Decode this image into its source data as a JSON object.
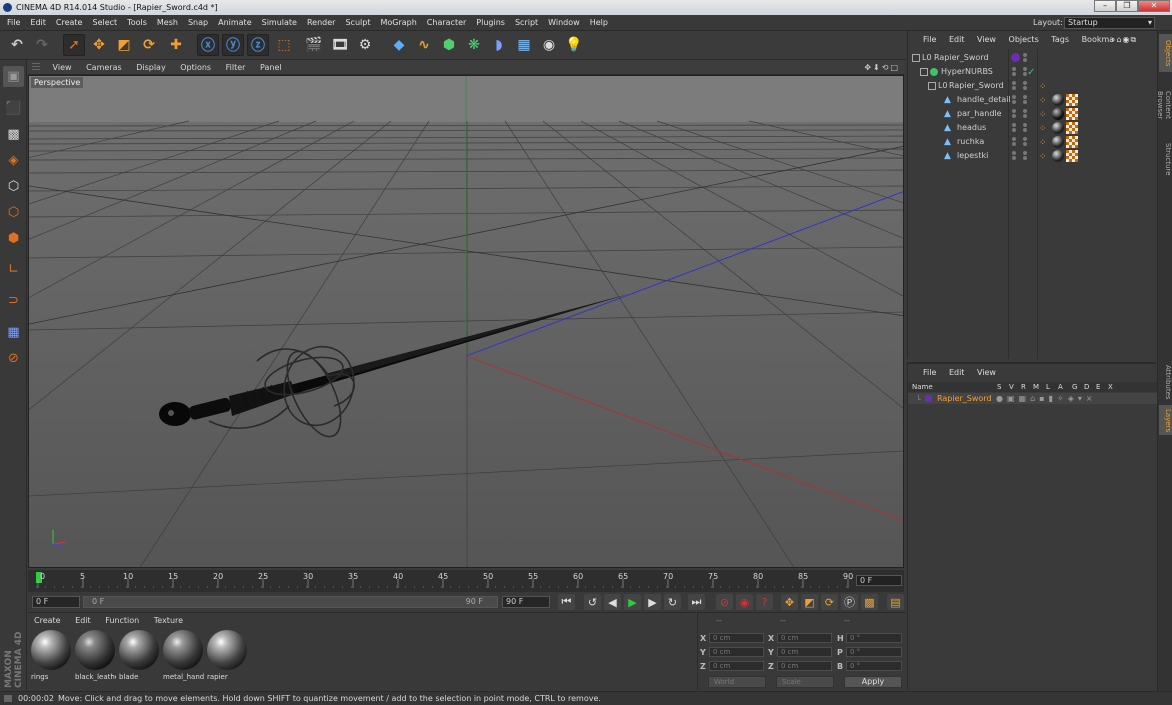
{
  "titlebar": {
    "title": "CINEMA 4D R14.014 Studio - [Rapier_Sword.c4d *]",
    "min": "–",
    "max": "❐",
    "close": "✕"
  },
  "menubar": {
    "items": [
      "File",
      "Edit",
      "Create",
      "Select",
      "Tools",
      "Mesh",
      "Snap",
      "Animate",
      "Simulate",
      "Render",
      "Sculpt",
      "MoGraph",
      "Character",
      "Plugins",
      "Script",
      "Window",
      "Help"
    ],
    "layout_label": "Layout:",
    "layout_value": "Startup"
  },
  "viewport": {
    "menu": [
      "View",
      "Cameras",
      "Display",
      "Options",
      "Filter",
      "Panel"
    ],
    "label": "Perspective",
    "nav_icons": "✥⬇⟲□"
  },
  "timeline": {
    "ticks": [
      "0",
      "5",
      "10",
      "15",
      "20",
      "25",
      "30",
      "35",
      "40",
      "45",
      "50",
      "55",
      "60",
      "65",
      "70",
      "75",
      "80",
      "85",
      "90"
    ],
    "current_frame": "0 F"
  },
  "transport": {
    "start": "0 F",
    "slider_start": "0 F",
    "slider_end": "90 F",
    "end": "90 F"
  },
  "materials": {
    "menu": [
      "Create",
      "Edit",
      "Function",
      "Texture"
    ],
    "items": [
      {
        "name": "rings",
        "color": "#c8c8c8"
      },
      {
        "name": "black_leather",
        "color": "#9a9a9a"
      },
      {
        "name": "blade",
        "color": "#b0b0b0"
      },
      {
        "name": "metal_handle",
        "color": "#a8a8a8"
      },
      {
        "name": "rapier",
        "color": "#c0c0c0"
      }
    ],
    "brand": "MAXON CINEMA 4D"
  },
  "coordinates": {
    "headers": [
      "--",
      "--",
      "--"
    ],
    "rows": [
      {
        "a": "X",
        "av": "0 cm",
        "b": "X",
        "bv": "0 cm",
        "c": "H",
        "cv": "0 °"
      },
      {
        "a": "Y",
        "av": "0 cm",
        "b": "Y",
        "bv": "0 cm",
        "c": "P",
        "cv": "0 °"
      },
      {
        "a": "Z",
        "av": "0 cm",
        "b": "Z",
        "bv": "0 cm",
        "c": "B",
        "cv": "0 °"
      }
    ],
    "space": "World",
    "mode": "Scale",
    "apply": "Apply"
  },
  "status": {
    "time": "00:00:02",
    "message": "Move: Click and drag to move elements. Hold down SHIFT to quantize movement / add to the selection in point mode, CTRL to remove."
  },
  "object_manager": {
    "menu": [
      "File",
      "Edit",
      "View",
      "Objects",
      "Tags",
      "Bookma"
    ],
    "objects": [
      {
        "name": "Rapier_Sword"
      },
      {
        "name": "HyperNURBS"
      },
      {
        "name": "Rapier_Sword"
      },
      {
        "name": "handle_detail"
      },
      {
        "name": "par_handle"
      },
      {
        "name": "headus"
      },
      {
        "name": "ruchka"
      },
      {
        "name": "lepestki"
      }
    ]
  },
  "layer_manager": {
    "menu": [
      "File",
      "Edit",
      "View"
    ],
    "columns": [
      "Name",
      "S",
      "V",
      "R",
      "M",
      "L",
      "A",
      "G",
      "D",
      "E",
      "X"
    ],
    "layers": [
      {
        "name": "Rapier_Sword",
        "color": "#6a2fb0"
      }
    ]
  },
  "right_tabs": [
    "Objects",
    "Content Browser",
    "Structure",
    "Attributes",
    "Layers"
  ],
  "colors": {
    "accent": "#f0a030",
    "x_axis": "#d33",
    "y_axis": "#3c3",
    "z_axis": "#44f"
  }
}
